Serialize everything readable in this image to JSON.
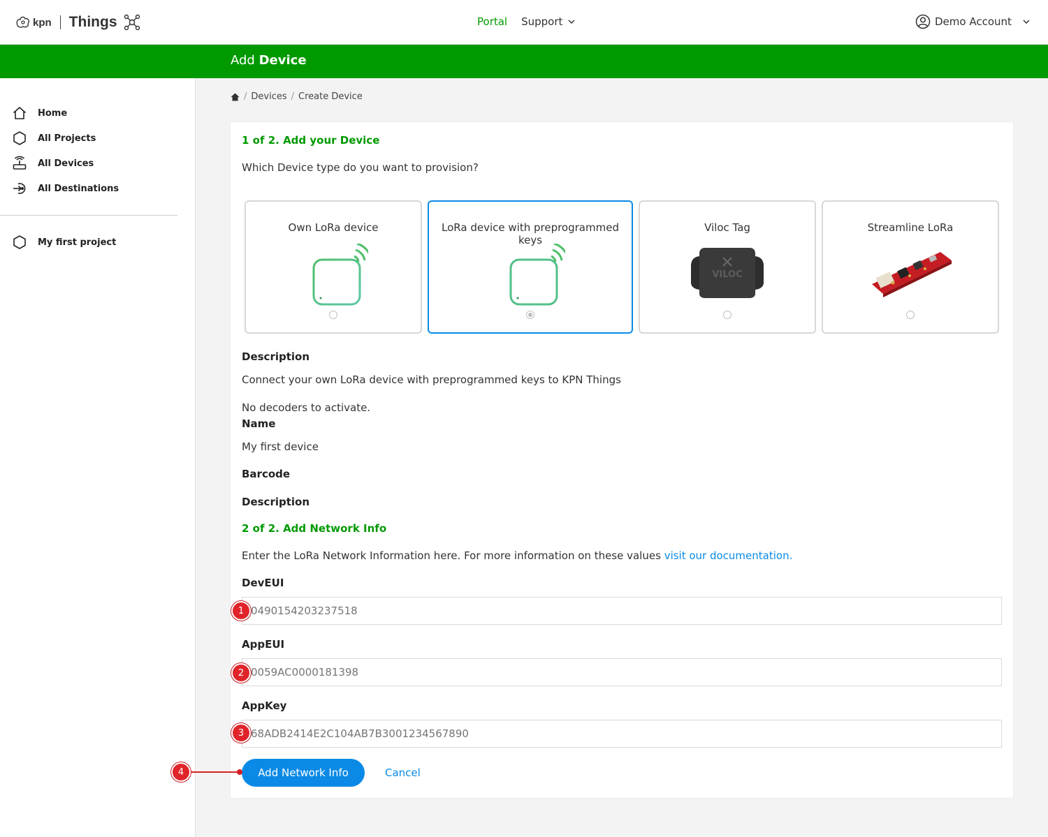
{
  "header": {
    "brand": "kpn",
    "product": "Things",
    "nav": [
      "Portal",
      "Support"
    ],
    "account": "Demo Account"
  },
  "greenbar": {
    "title_light": "Add",
    "title_bold": "Device"
  },
  "sidebar": {
    "items": [
      {
        "label": "Home",
        "icon": "home-icon"
      },
      {
        "label": "All Projects",
        "icon": "hexagon-icon"
      },
      {
        "label": "All Devices",
        "icon": "router-icon"
      },
      {
        "label": "All Destinations",
        "icon": "destination-icon"
      }
    ],
    "projects": [
      {
        "label": "My first project",
        "icon": "hexagon-icon"
      }
    ]
  },
  "breadcrumb": {
    "home_icon": "home-icon",
    "items": [
      "Devices",
      "Create Device"
    ]
  },
  "step1": {
    "title": "1 of 2. Add your Device",
    "question": "Which Device type do you want to provision?",
    "device_types": [
      {
        "label": "Own LoRa device",
        "selected": false
      },
      {
        "label": "LoRa device with preprogrammed keys",
        "selected": true
      },
      {
        "label": "Viloc Tag",
        "selected": false
      },
      {
        "label": "Streamline LoRa",
        "selected": false
      }
    ],
    "description_label": "Description",
    "description_text": "Connect your own LoRa device with preprogrammed keys to KPN Things",
    "decoders_text": "No decoders to activate.",
    "name_label": "Name",
    "name_value": "My first device",
    "barcode_label": "Barcode",
    "description2_label": "Description"
  },
  "step2": {
    "title": "2 of 2. Add Network Info",
    "info_text": "Enter the LoRa Network Information here. For more information on these values",
    "info_link": "visit our documentation.",
    "fields": [
      {
        "label": "DevEUI",
        "placeholder": "0490154203237518"
      },
      {
        "label": "AppEUI",
        "placeholder": "0059AC0000181398"
      },
      {
        "label": "AppKey",
        "placeholder": "68ADB2414E2C104AB7B3001234567890"
      }
    ],
    "submit": "Add Network Info",
    "cancel": "Cancel"
  },
  "annotations": [
    "1",
    "2",
    "3",
    "4"
  ],
  "colors": {
    "brand_green": "#009900",
    "link_blue": "#0a8ae6",
    "marker_red": "#e0242a"
  }
}
